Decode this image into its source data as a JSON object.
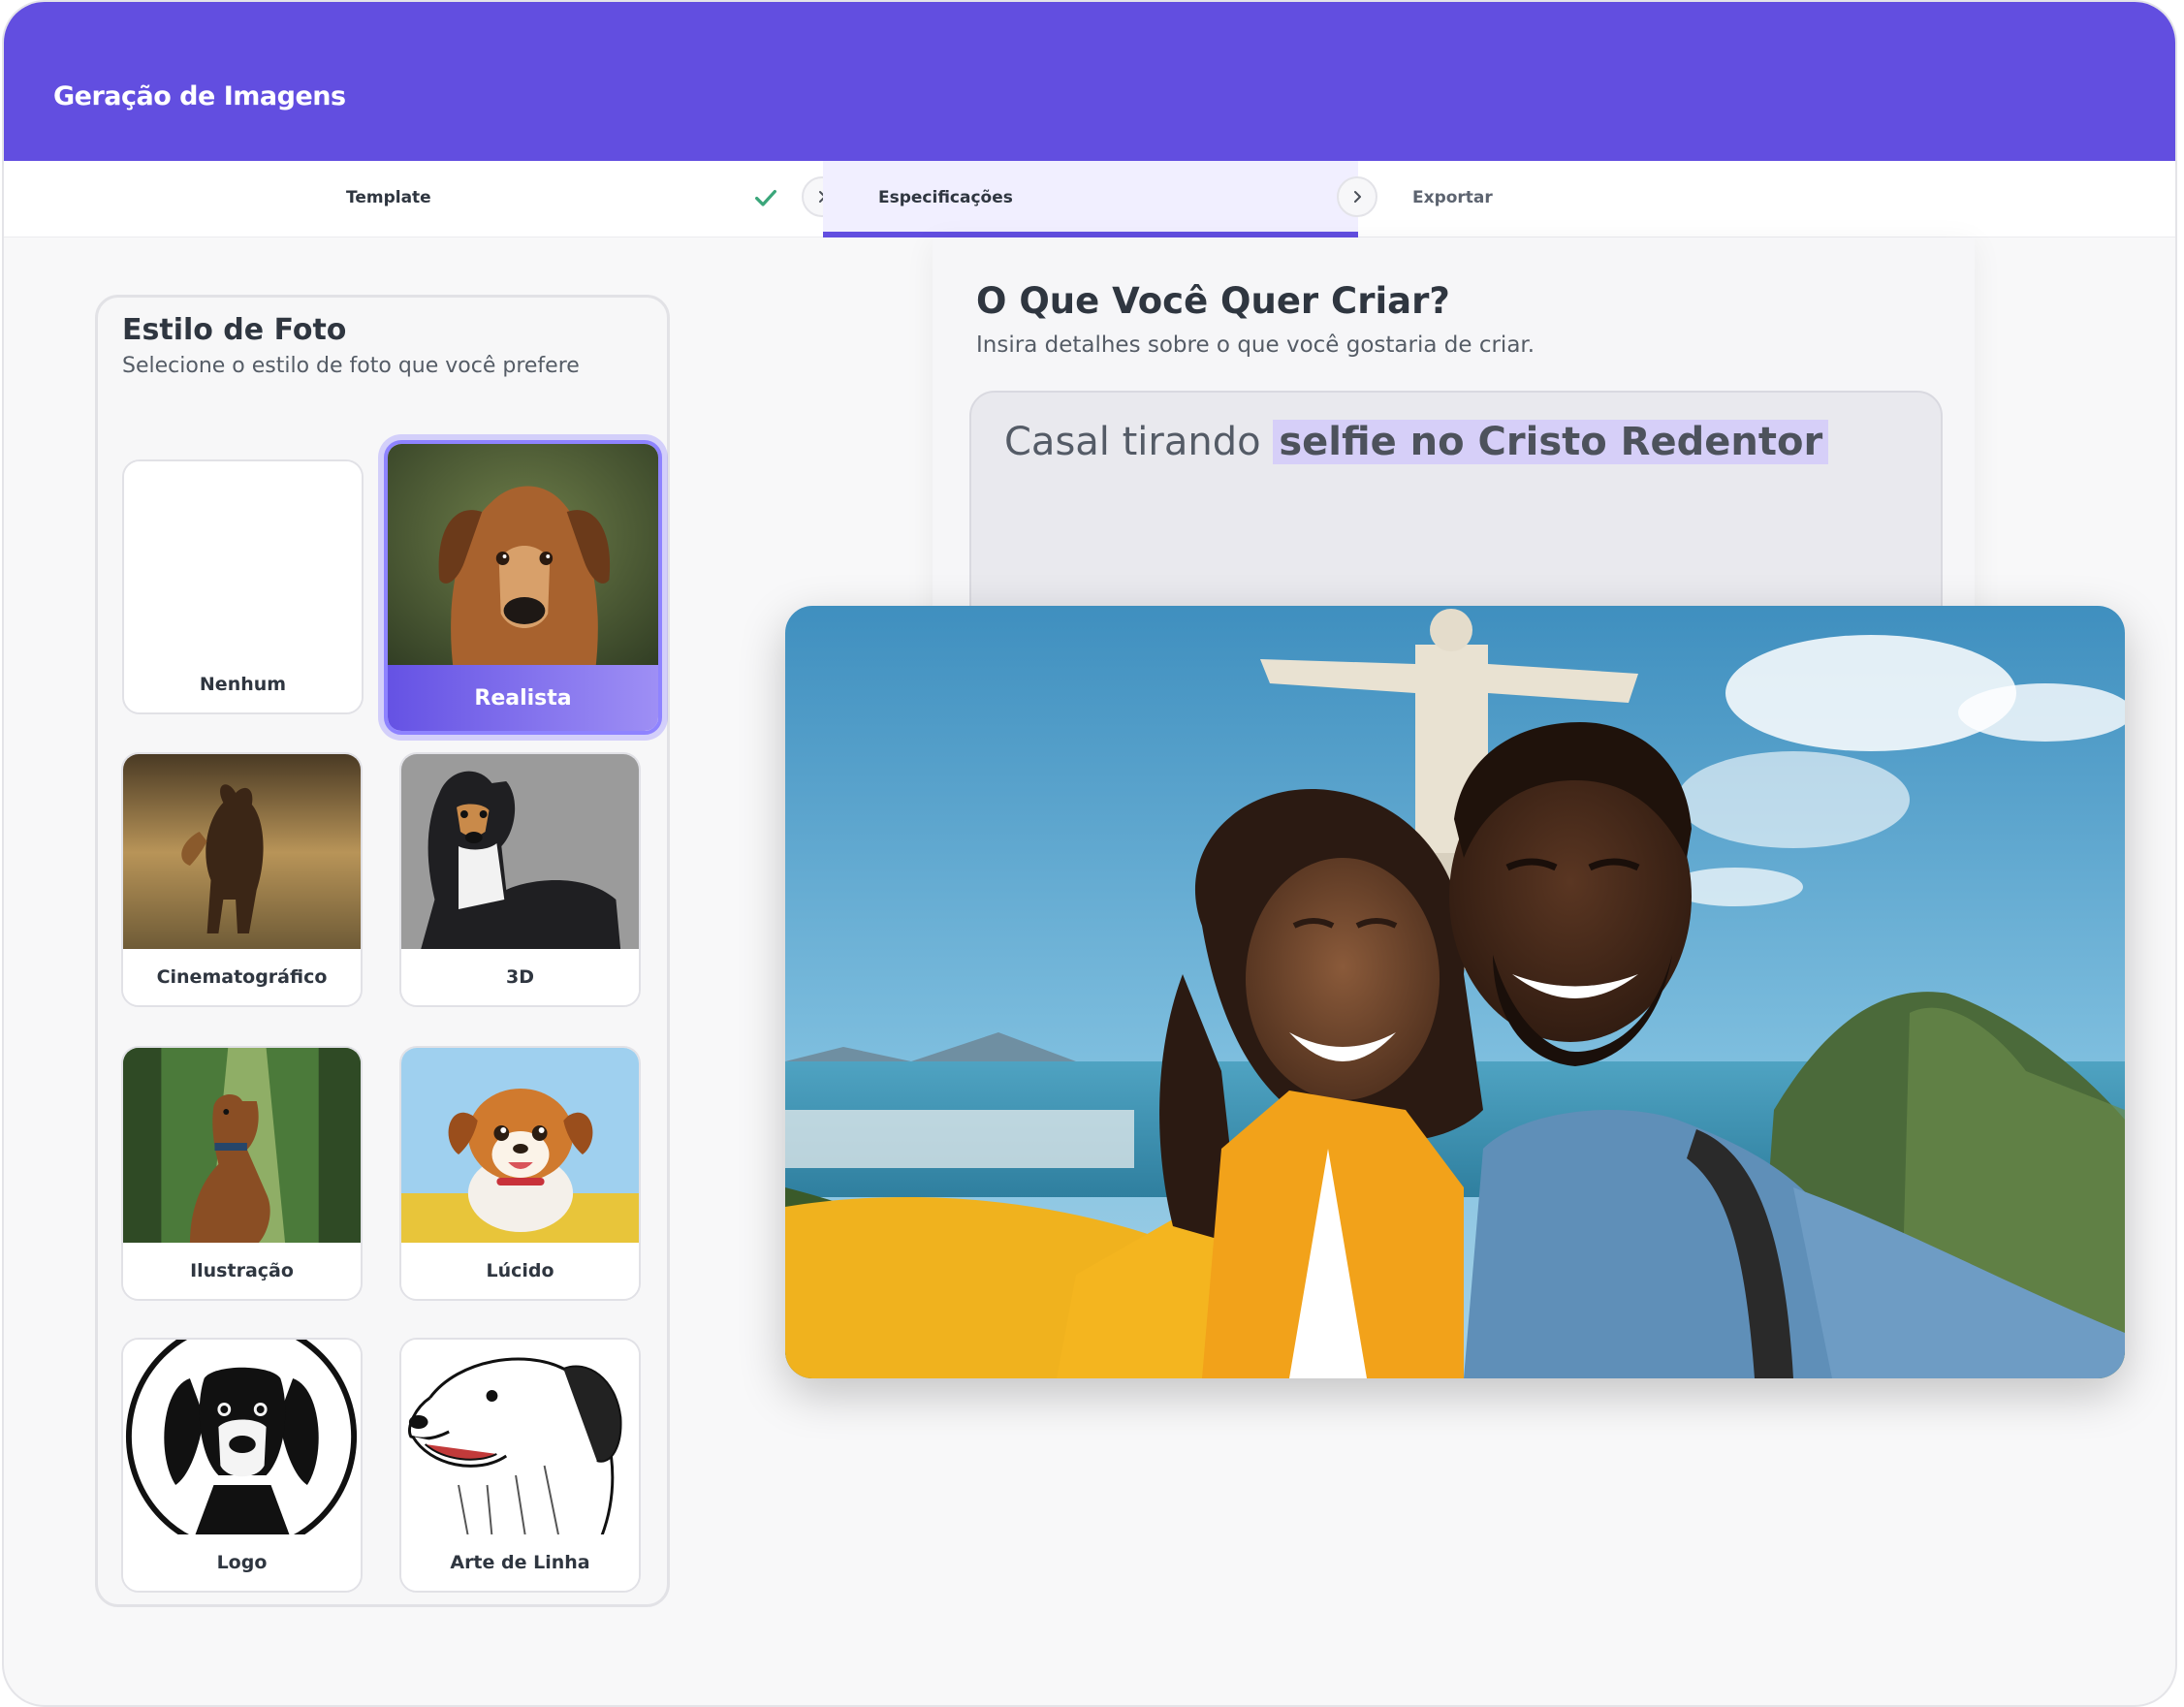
{
  "header": {
    "title": "Geração de Imagens"
  },
  "steps": [
    {
      "label": "Template",
      "state": "done",
      "icon": "check-icon"
    },
    {
      "label": "Especificações",
      "state": "active"
    },
    {
      "label": "Exportar",
      "state": "pending"
    }
  ],
  "style_panel": {
    "title": "Estilo de Foto",
    "subtitle": "Selecione o estilo de foto que você prefere",
    "options": [
      {
        "label": "Nenhum",
        "selected": false
      },
      {
        "label": "Realista",
        "selected": true
      },
      {
        "label": "Cinematográfico",
        "selected": false
      },
      {
        "label": "3D",
        "selected": false
      },
      {
        "label": "Ilustração",
        "selected": false
      },
      {
        "label": "Lúcido",
        "selected": false
      },
      {
        "label": "Logo",
        "selected": false
      },
      {
        "label": "Arte de Linha",
        "selected": false
      }
    ]
  },
  "create_panel": {
    "title": "O Que Você Quer Criar?",
    "subtitle": "Insira detalhes sobre o que você gostaria de criar.",
    "prompt_plain": "Casal tirando",
    "prompt_highlight": "selfie no Cristo Redentor"
  },
  "colors": {
    "brand": "#624ee0",
    "check": "#3aa67a",
    "highlight": "#d6cff8"
  }
}
